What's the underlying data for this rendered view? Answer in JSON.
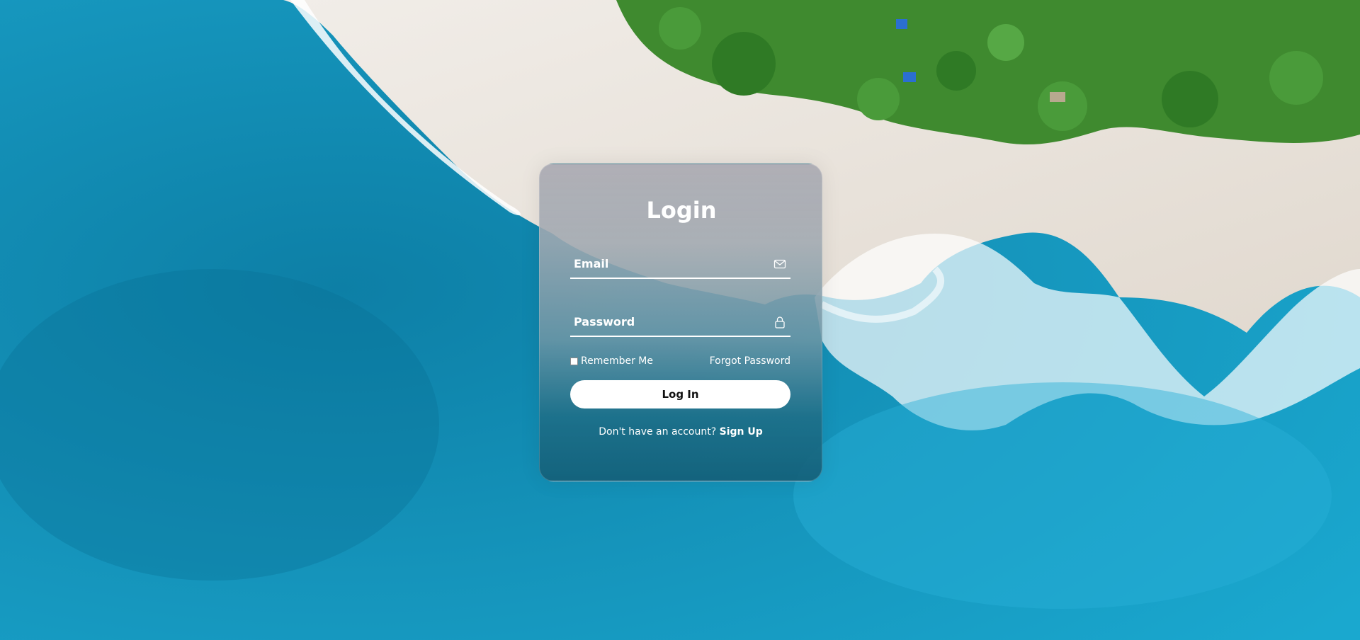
{
  "login": {
    "title": "Login",
    "email_placeholder": "Email",
    "password_placeholder": "Password",
    "remember_label": "Remember Me",
    "forgot_label": "Forgot Password",
    "submit_label": "Log In",
    "signup_prompt": "Don't have an account?",
    "signup_label": "Sign Up"
  },
  "icons": {
    "email": "envelope-icon",
    "password": "lock-icon"
  },
  "colors": {
    "ocean": "#1aa0c4",
    "sand": "#e8e2da",
    "foliage": "#3f8a2f",
    "button": "#ffffff",
    "text": "#ffffff"
  }
}
